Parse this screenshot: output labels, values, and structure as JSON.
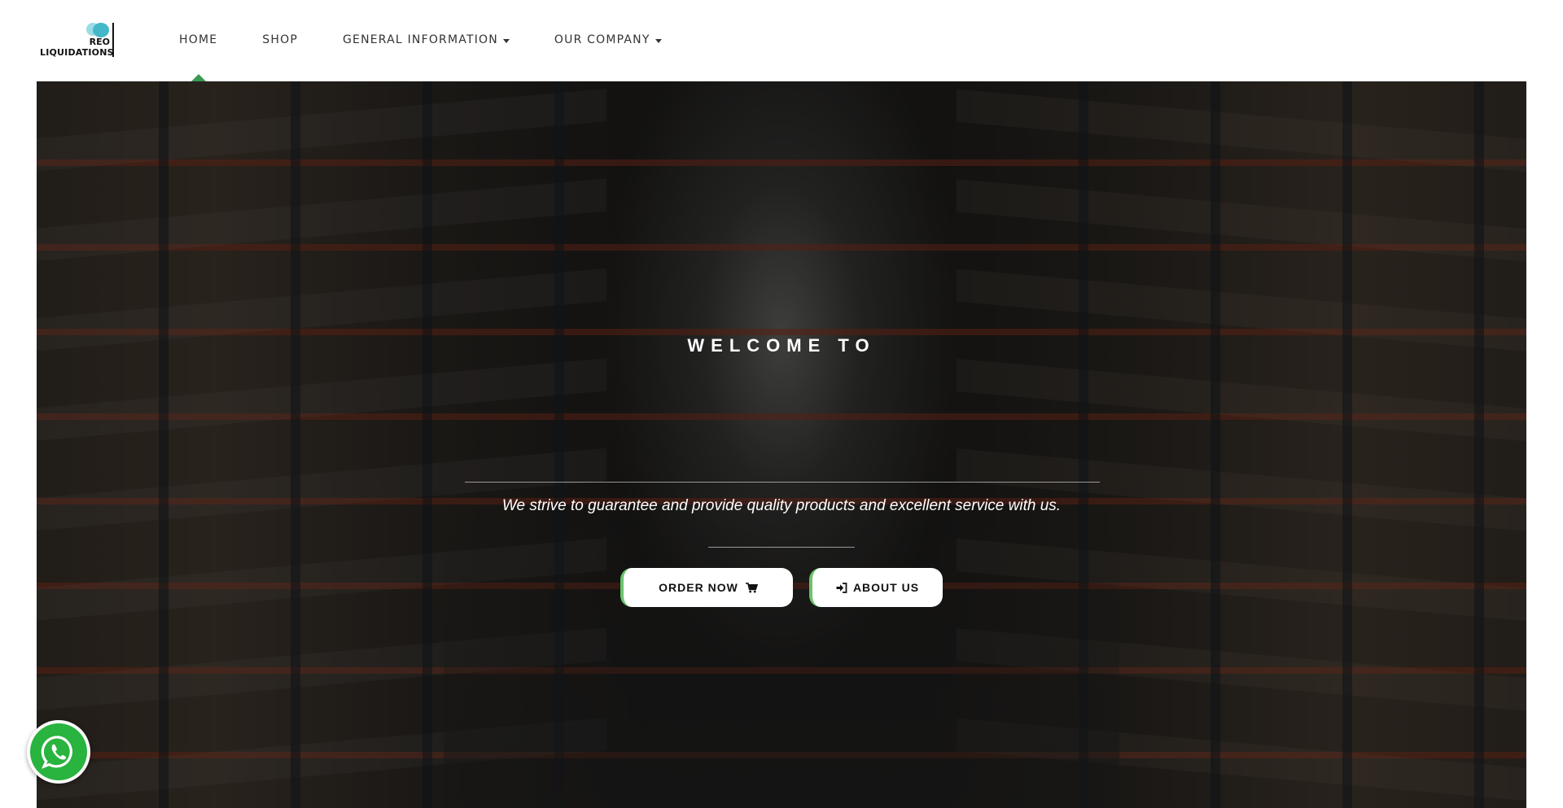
{
  "brand": {
    "logo_line1": "REO",
    "logo_line2": "LIQUIDATIONS"
  },
  "nav": {
    "items": [
      {
        "label": "HOME",
        "active": true,
        "dropdown": false
      },
      {
        "label": "SHOP",
        "active": false,
        "dropdown": false
      },
      {
        "label": "GENERAL INFORMATION",
        "active": false,
        "dropdown": true
      },
      {
        "label": "OUR COMPANY",
        "active": false,
        "dropdown": true
      }
    ]
  },
  "hero": {
    "welcome": "WELCOME TO",
    "tagline": "We strive to guarantee and provide quality products and excellent service with us.",
    "order_button": "ORDER NOW",
    "order_icon": "shopping-cart-icon",
    "about_button": "ABOUT US",
    "about_icon": "sign-in-icon"
  },
  "floating": {
    "whatsapp_icon": "whatsapp-icon"
  },
  "colors": {
    "accent_green": "#3a9a55",
    "button_border_green": "#6cc36c",
    "whatsapp_green": "#29b33f",
    "logo_teal": "#44b7c9"
  }
}
